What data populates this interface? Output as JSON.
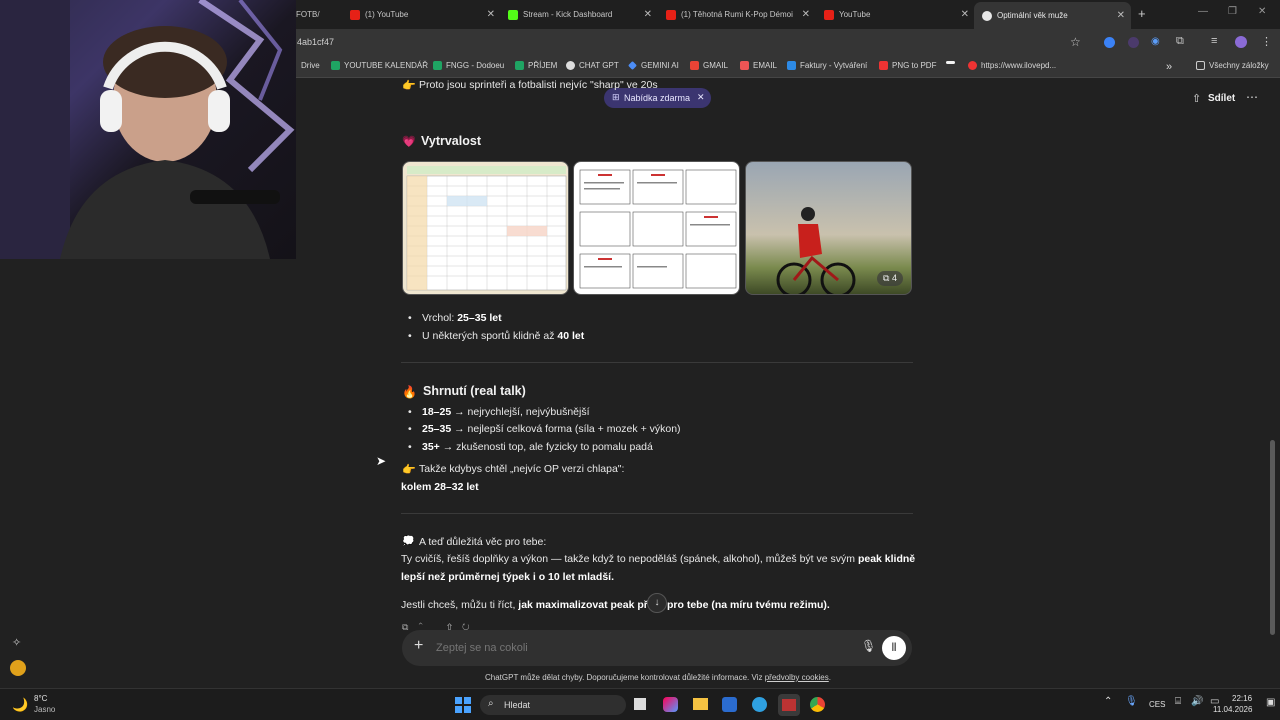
{
  "tabs": [
    {
      "label": "FOTB/",
      "icon": "football-icon"
    },
    {
      "label": "(1) YouTube",
      "icon": "youtube-icon"
    },
    {
      "label": "Stream - Kick Dashboard",
      "icon": "kick-icon"
    },
    {
      "label": "(1) Těhotná Rumi K-Pop Démoi",
      "icon": "youtube-icon"
    },
    {
      "label": "YouTube",
      "icon": "youtube-icon"
    },
    {
      "label": "Optimální věk muže",
      "icon": "chatgpt-icon"
    }
  ],
  "address": {
    "url": "4ab1cf47"
  },
  "bookmarks": [
    {
      "label": "Drive"
    },
    {
      "label": "YOUTUBE KALENDÁŘ"
    },
    {
      "label": "FNGG - Dodoeu"
    },
    {
      "label": "PŘÍJEM"
    },
    {
      "label": "CHAT GPT"
    },
    {
      "label": "GEMINI AI"
    },
    {
      "label": "GMAIL"
    },
    {
      "label": "EMAIL"
    },
    {
      "label": "Faktury - Vytváření"
    },
    {
      "label": "PNG to PDF"
    },
    {
      "label": "https://www.ilovepd..."
    },
    {
      "label": "Všechny záložky"
    }
  ],
  "header": {
    "share_label": "Sdílet",
    "offer_label": "Nabídka zdarma"
  },
  "chat": {
    "top_line": "Proto jsou sprinteři a fotbalisti nejvíc \"sharp\" ve 20s",
    "endurance_heading": "Vytrvalost",
    "gallery_count": "4",
    "endurance_bullets": [
      {
        "label": "Vrchol: ",
        "value": "25–35 let"
      },
      {
        "label": "U některých sportů klidně až ",
        "value": "40 let"
      }
    ],
    "summary_heading": "Shrnutí (real talk)",
    "summary_bullets": [
      {
        "range": "18–25",
        "text": " → nejrychlejší, nejvýbušnější"
      },
      {
        "range": "25–35",
        "text": " → nejlepší celková forma (síla + mozek + výkon)"
      },
      {
        "range": "35+",
        "text": " → zkušenosti top, ale fyzicky to pomalu padá"
      }
    ],
    "conclusion_intro": "Takže kdybys chtěl „nejvíc OP verzi chlapa\":",
    "conclusion_value": "kolem 28–32 let",
    "important_heading": "A teď důležitá věc pro tebe:",
    "important_text_1": "Ty cvičíš, řešíš doplňky a výkon — takže když to nepoděláš (spánek, alkohol), můžeš být ve svým ",
    "important_bold_1": "peak klidně",
    "important_bold_2": "lepší než průměrnej týpek i o 10 let mladší.",
    "final_text": "Jestli chceš, můžu ti říct, ",
    "final_bold_a": "jak maximalizovat peak pře",
    "final_bold_b": "pro tebe (na míru tvému režimu)."
  },
  "composer": {
    "placeholder": "Zeptej se na cokoli"
  },
  "footer": {
    "note": "ChatGPT může dělat chyby. Doporučujeme kontrolovat důležité informace. Viz ",
    "link": "předvolby cookies",
    "end": "."
  },
  "taskbar": {
    "weather_temp": "8°C",
    "weather_desc": "Jasno",
    "search_placeholder": "Hledat",
    "language": "CES",
    "time": "22:16",
    "date": "11.04.2026"
  },
  "colors": {
    "youtube": "#e62117",
    "kick": "#53fc18",
    "accent": "#4f46e5"
  }
}
